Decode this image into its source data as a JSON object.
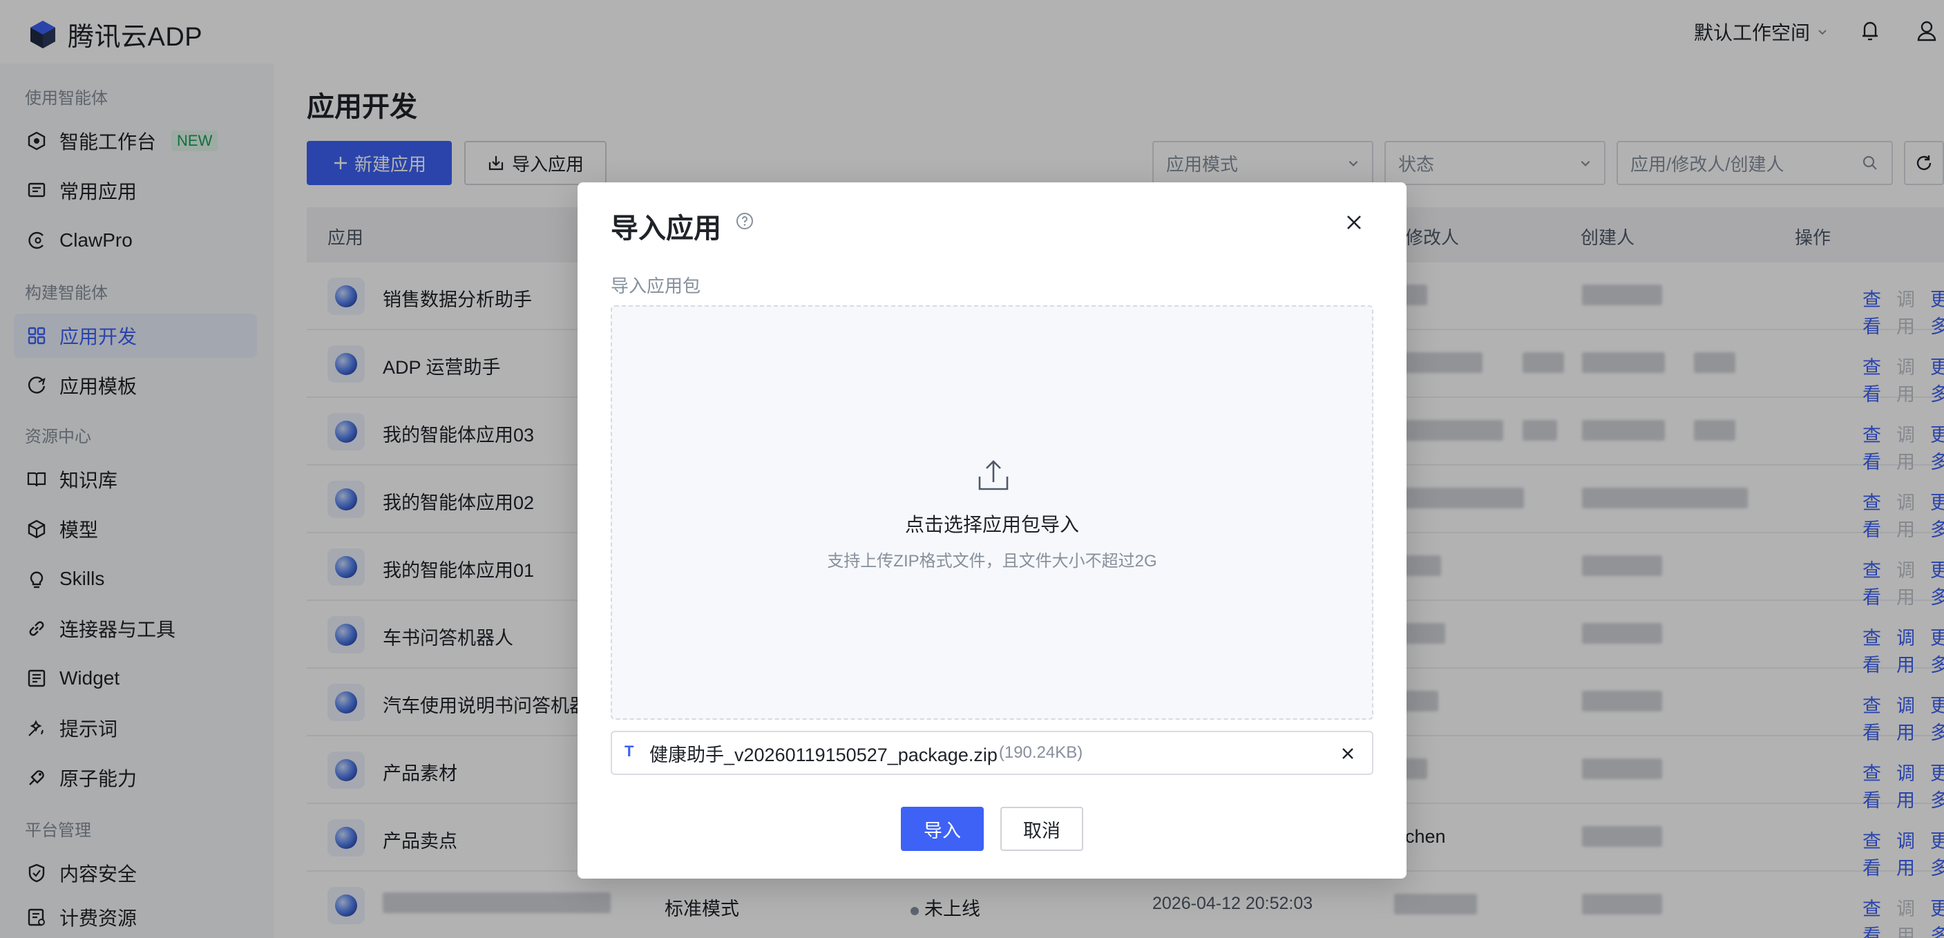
{
  "header": {
    "brand": "腾讯云ADP",
    "workspace": "默认工作空间"
  },
  "sidebar": {
    "groups": [
      "使用智能体",
      "构建智能体",
      "资源中心",
      "平台管理"
    ],
    "items": [
      {
        "label": "智能工作台",
        "badge": "NEW",
        "icon": "cube-icon"
      },
      {
        "label": "常用应用",
        "icon": "chat-icon"
      },
      {
        "label": "ClawPro",
        "icon": "claw-icon"
      },
      {
        "label": "应用开发",
        "icon": "grid-icon",
        "active": true
      },
      {
        "label": "应用模板",
        "icon": "template-icon"
      },
      {
        "label": "知识库",
        "icon": "book-icon"
      },
      {
        "label": "模型",
        "icon": "model-icon"
      },
      {
        "label": "Skills",
        "icon": "bulb-icon"
      },
      {
        "label": "连接器与工具",
        "icon": "link-icon"
      },
      {
        "label": "Widget",
        "icon": "widget-icon"
      },
      {
        "label": "提示词",
        "icon": "prompt-icon"
      },
      {
        "label": "原子能力",
        "icon": "atom-icon"
      },
      {
        "label": "内容安全",
        "icon": "shield-icon"
      },
      {
        "label": "计费资源",
        "icon": "billing-icon"
      }
    ]
  },
  "main": {
    "title": "应用开发",
    "new_button": "新建应用",
    "import_button": "导入应用",
    "filters": {
      "mode_placeholder": "应用模式",
      "status_placeholder": "状态",
      "search_placeholder": "应用/修改人/创建人"
    },
    "columns": {
      "app": "应用",
      "modifier": "修改人",
      "creator": "创建人",
      "actions": "操作"
    },
    "ops": {
      "view": "查看",
      "debug": "调用",
      "more": "更多"
    },
    "rows": [
      {
        "name": "销售数据分析助手",
        "debug_enabled": false
      },
      {
        "name": "ADP 运营助手",
        "debug_enabled": false
      },
      {
        "name": "我的智能体应用03",
        "debug_enabled": false
      },
      {
        "name": "我的智能体应用02",
        "debug_enabled": false
      },
      {
        "name": "我的智能体应用01",
        "debug_enabled": false
      },
      {
        "name": "车书问答机器人",
        "debug_enabled": true
      },
      {
        "name": "汽车使用说明书问答机器",
        "debug_enabled": true
      },
      {
        "name": "产品素材",
        "debug_enabled": true
      },
      {
        "name": "产品卖点",
        "debug_enabled": true,
        "modifier_text": "chen"
      },
      {
        "name": "",
        "debug_enabled": false,
        "mode": "标准模式",
        "status": "未上线",
        "time": "2026-04-12 20:52:03"
      }
    ]
  },
  "modal": {
    "title": "导入应用",
    "field_label": "导入应用包",
    "dropzone_title": "点击选择应用包导入",
    "dropzone_hint": "支持上传ZIP格式文件，且文件大小不超过2G",
    "file_type": "T",
    "file_name": "健康助手_v20260119150527_package.zip",
    "file_size": "(190.24KB)",
    "ok": "导入",
    "cancel": "取消"
  },
  "colors": {
    "primary": "#3d62f5",
    "overlay": "rgba(0,0,0,0.30)",
    "new_badge": "#18a058"
  }
}
